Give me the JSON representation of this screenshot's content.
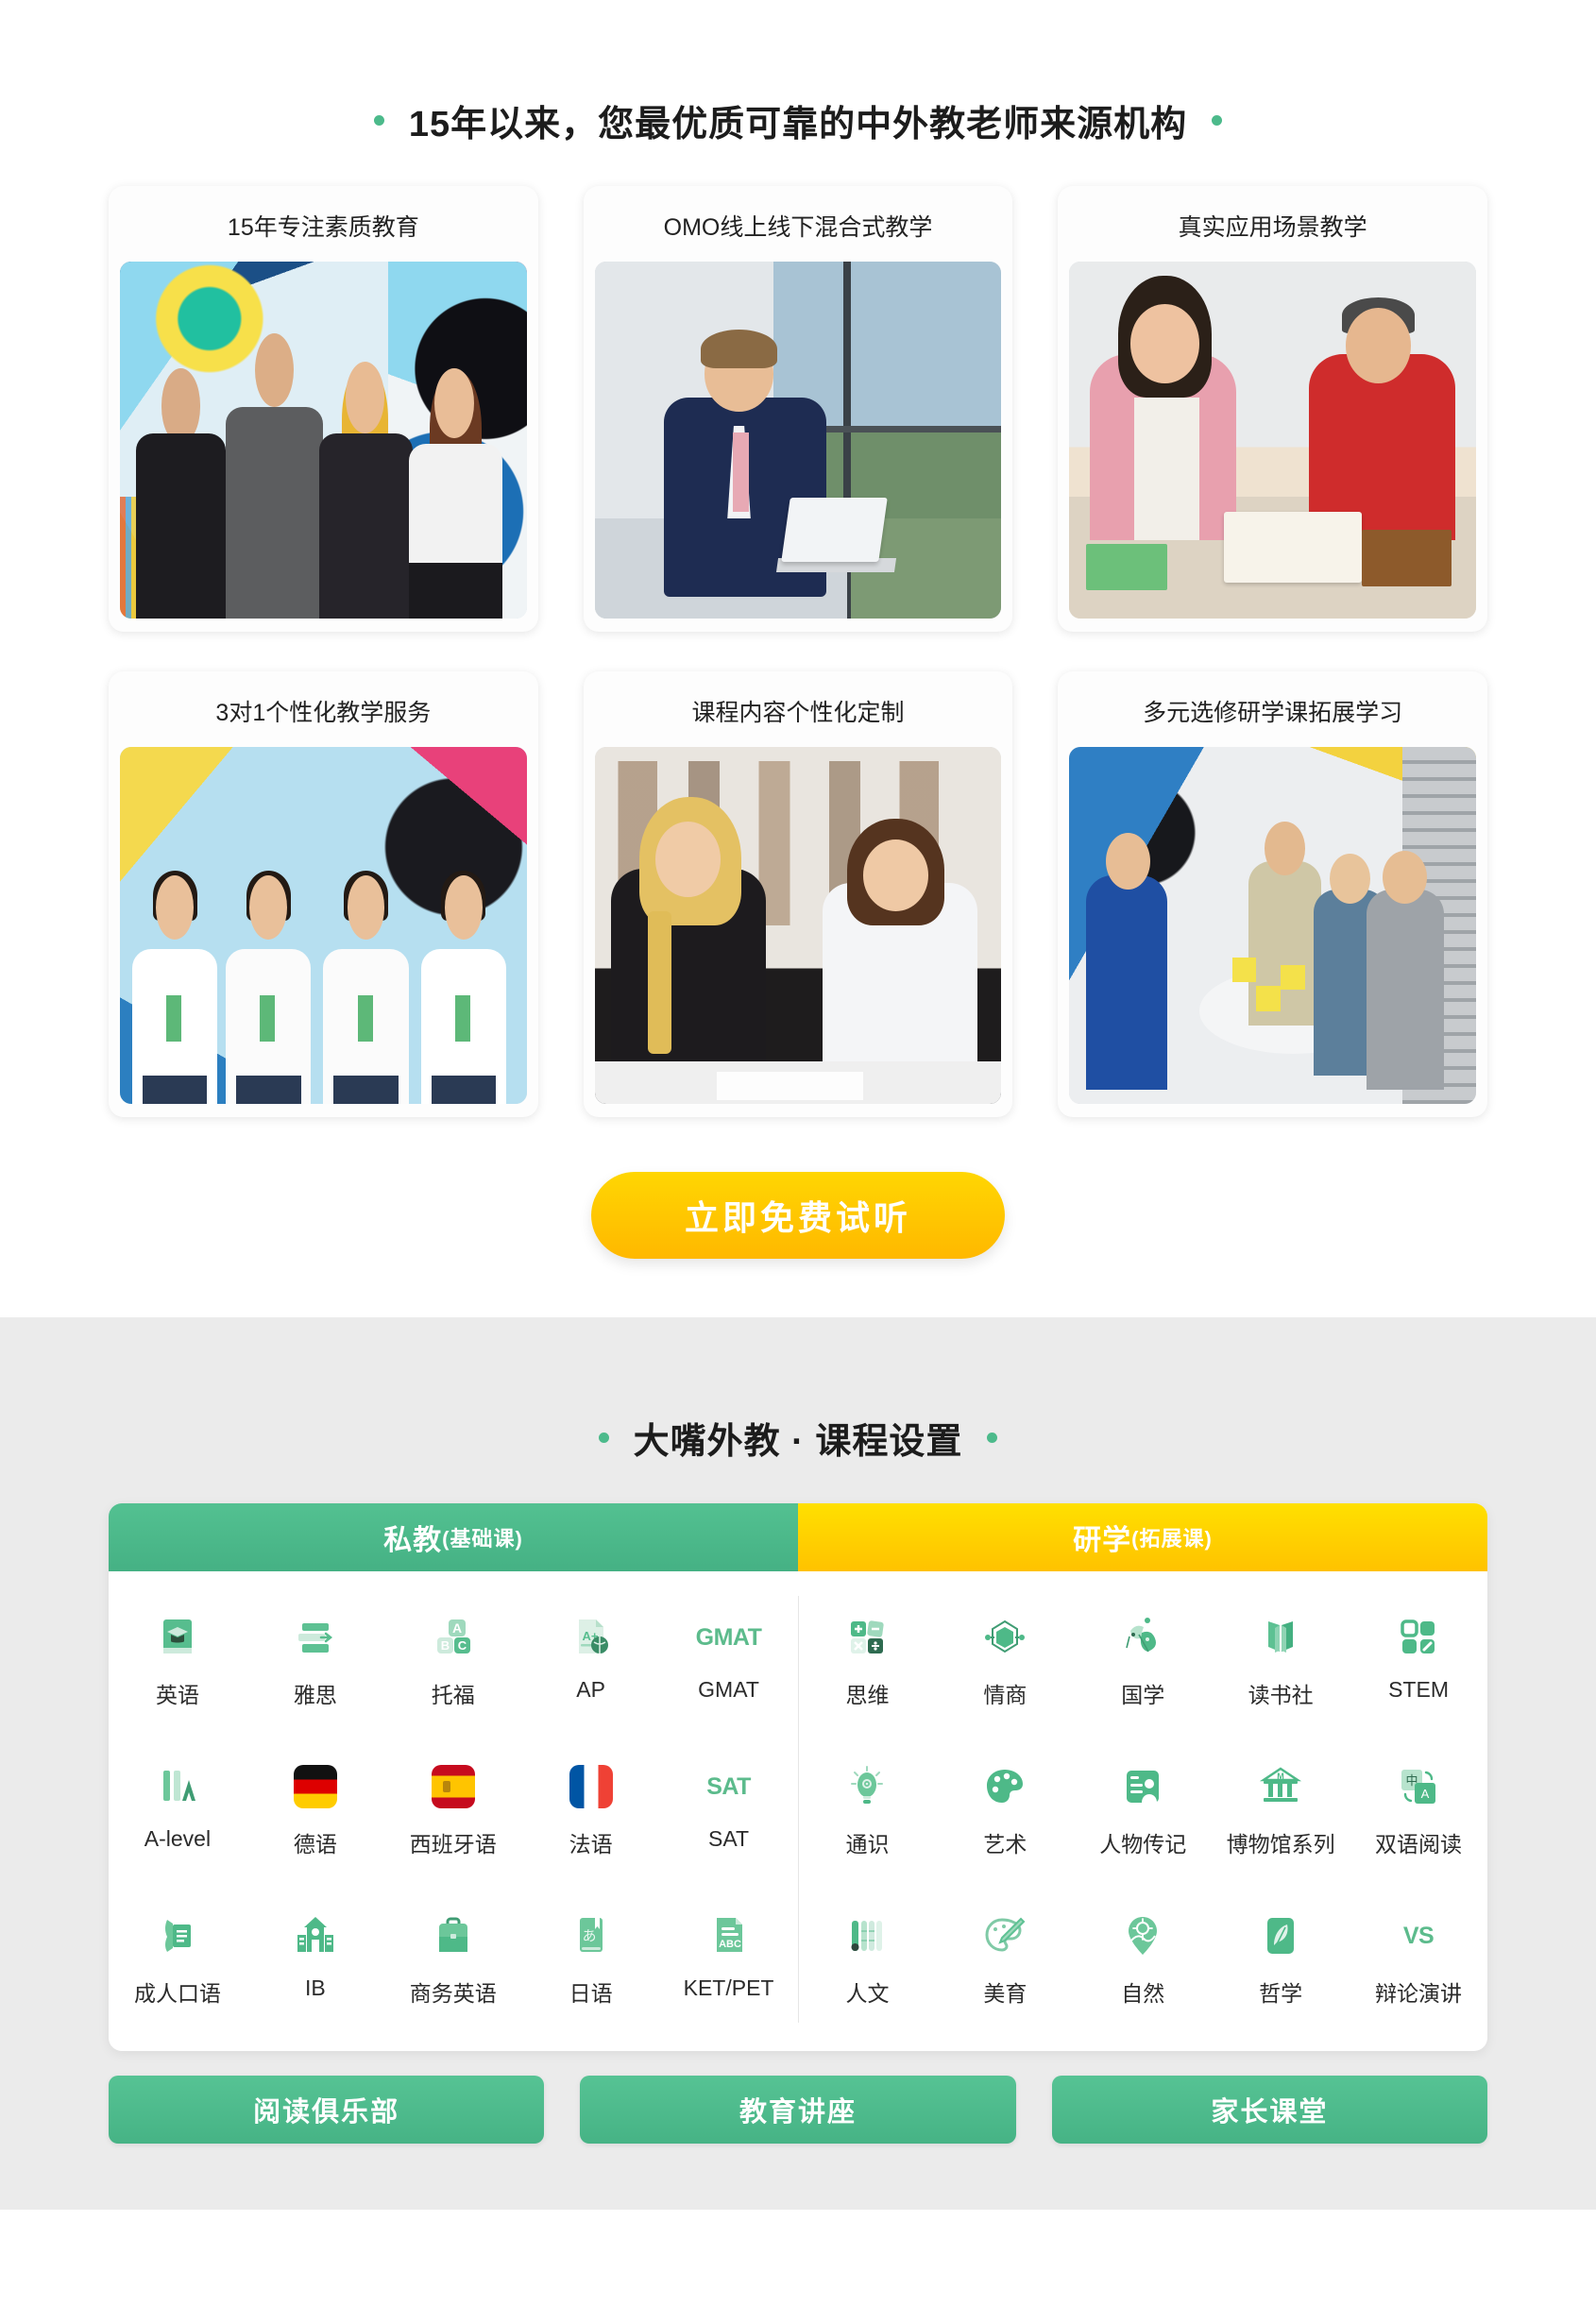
{
  "advantages": {
    "heading": "15年以来，您最优质可靠的中外教老师来源机构",
    "accent_dot_color": "#4cba8b",
    "cards": [
      {
        "title": "15年专注素质教育",
        "photo": "team-thumbs-up-mural-photo"
      },
      {
        "title": "OMO线上线下混合式教学",
        "photo": "man-laptop-window-photo"
      },
      {
        "title": "真实应用场景教学",
        "photo": "teacher-student-books-photo"
      },
      {
        "title": "3对1个性化教学服务",
        "photo": "students-thumbs-up-mural-photo"
      },
      {
        "title": "课程内容个性化定制",
        "photo": "tutor-student-desk-photo"
      },
      {
        "title": "多元选修研学课拓展学习",
        "photo": "group-study-table-photo"
      }
    ],
    "cta_label": "立即免费试听",
    "cta_color": "#ffc800"
  },
  "courses": {
    "heading": "大嘴外教 · 课程设置",
    "tabs": [
      {
        "label": "私教",
        "sub": "(基础课)",
        "color": "#4cba8b"
      },
      {
        "label": "研学",
        "sub": "(拓展课)",
        "color": "#ffc800"
      }
    ],
    "left_items": [
      {
        "label": "英语",
        "icon": "book-graduation-cap-icon"
      },
      {
        "label": "雅思",
        "icon": "ielts-bars-arrow-icon"
      },
      {
        "label": "托福",
        "icon": "abc-blocks-icon"
      },
      {
        "label": "AP",
        "icon": "a-plus-paper-globe-icon"
      },
      {
        "label": "GMAT",
        "icon": "gmat-wordmark-icon"
      },
      {
        "label": "A-level",
        "icon": "a-level-letters-icon"
      },
      {
        "label": "德语",
        "icon": "germany-flag-icon"
      },
      {
        "label": "西班牙语",
        "icon": "spain-flag-icon"
      },
      {
        "label": "法语",
        "icon": "france-flag-icon"
      },
      {
        "label": "SAT",
        "icon": "sat-wordmark-icon"
      },
      {
        "label": "成人口语",
        "icon": "speaking-document-icon"
      },
      {
        "label": "IB",
        "icon": "school-building-icon"
      },
      {
        "label": "商务英语",
        "icon": "briefcase-icon"
      },
      {
        "label": "日语",
        "icon": "japanese-book-icon"
      },
      {
        "label": "KET/PET",
        "icon": "abc-paper-icon"
      }
    ],
    "right_items": [
      {
        "label": "思维",
        "icon": "math-operators-icon"
      },
      {
        "label": "情商",
        "icon": "hexagon-molecule-icon"
      },
      {
        "label": "国学",
        "icon": "opera-mask-icon"
      },
      {
        "label": "读书社",
        "icon": "open-book-icon"
      },
      {
        "label": "STEM",
        "icon": "four-blocks-icon"
      },
      {
        "label": "通识",
        "icon": "lightbulb-icon"
      },
      {
        "label": "艺术",
        "icon": "palette-icon"
      },
      {
        "label": "人物传记",
        "icon": "person-profile-card-icon"
      },
      {
        "label": "博物馆系列",
        "icon": "museum-building-icon"
      },
      {
        "label": "双语阅读",
        "icon": "translate-cn-a-icon"
      },
      {
        "label": "人文",
        "icon": "bamboo-scroll-icon"
      },
      {
        "label": "美育",
        "icon": "paintbrush-palette-icon"
      },
      {
        "label": "自然",
        "icon": "nature-pin-icon"
      },
      {
        "label": "哲学",
        "icon": "feather-quill-icon"
      },
      {
        "label": "辩论演讲",
        "icon": "vs-wordmark-icon"
      }
    ],
    "bottom_buttons": [
      "阅读俱乐部",
      "教育讲座",
      "家长课堂"
    ]
  }
}
